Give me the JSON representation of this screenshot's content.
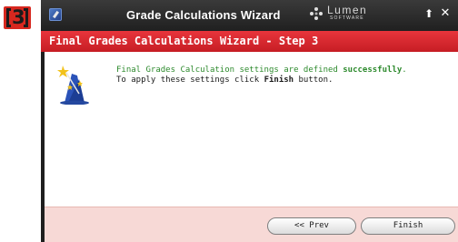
{
  "step_badge": {
    "number": "3"
  },
  "window": {
    "title": "Grade Calculations Wizard"
  },
  "brand": {
    "name": "Lumen",
    "subtitle": "SOFTWARE"
  },
  "title_buttons": {
    "maximize": "⬆",
    "close": "✕"
  },
  "header": {
    "title": "Final Grades Calculations Wizard - Step 3"
  },
  "message": {
    "line1_prefix": "Final Grades Calculation settings are defined ",
    "line1_emphasis": "successfully",
    "line1_suffix": ".",
    "line2_prefix": "To apply these settings click ",
    "line2_emphasis": "Finish",
    "line2_suffix": " button."
  },
  "buttons": {
    "prev": "<< Prev",
    "finish": "Finish"
  },
  "colors": {
    "accent_red": "#d7281f",
    "header_red": "#e8353c",
    "footer_bg": "#f7d9d6",
    "success_green": "#2d8a2d"
  },
  "icons": {
    "app": "wizard-app-icon",
    "brand": "lumen-logo-icon",
    "content": "wizard-hat-icon"
  }
}
